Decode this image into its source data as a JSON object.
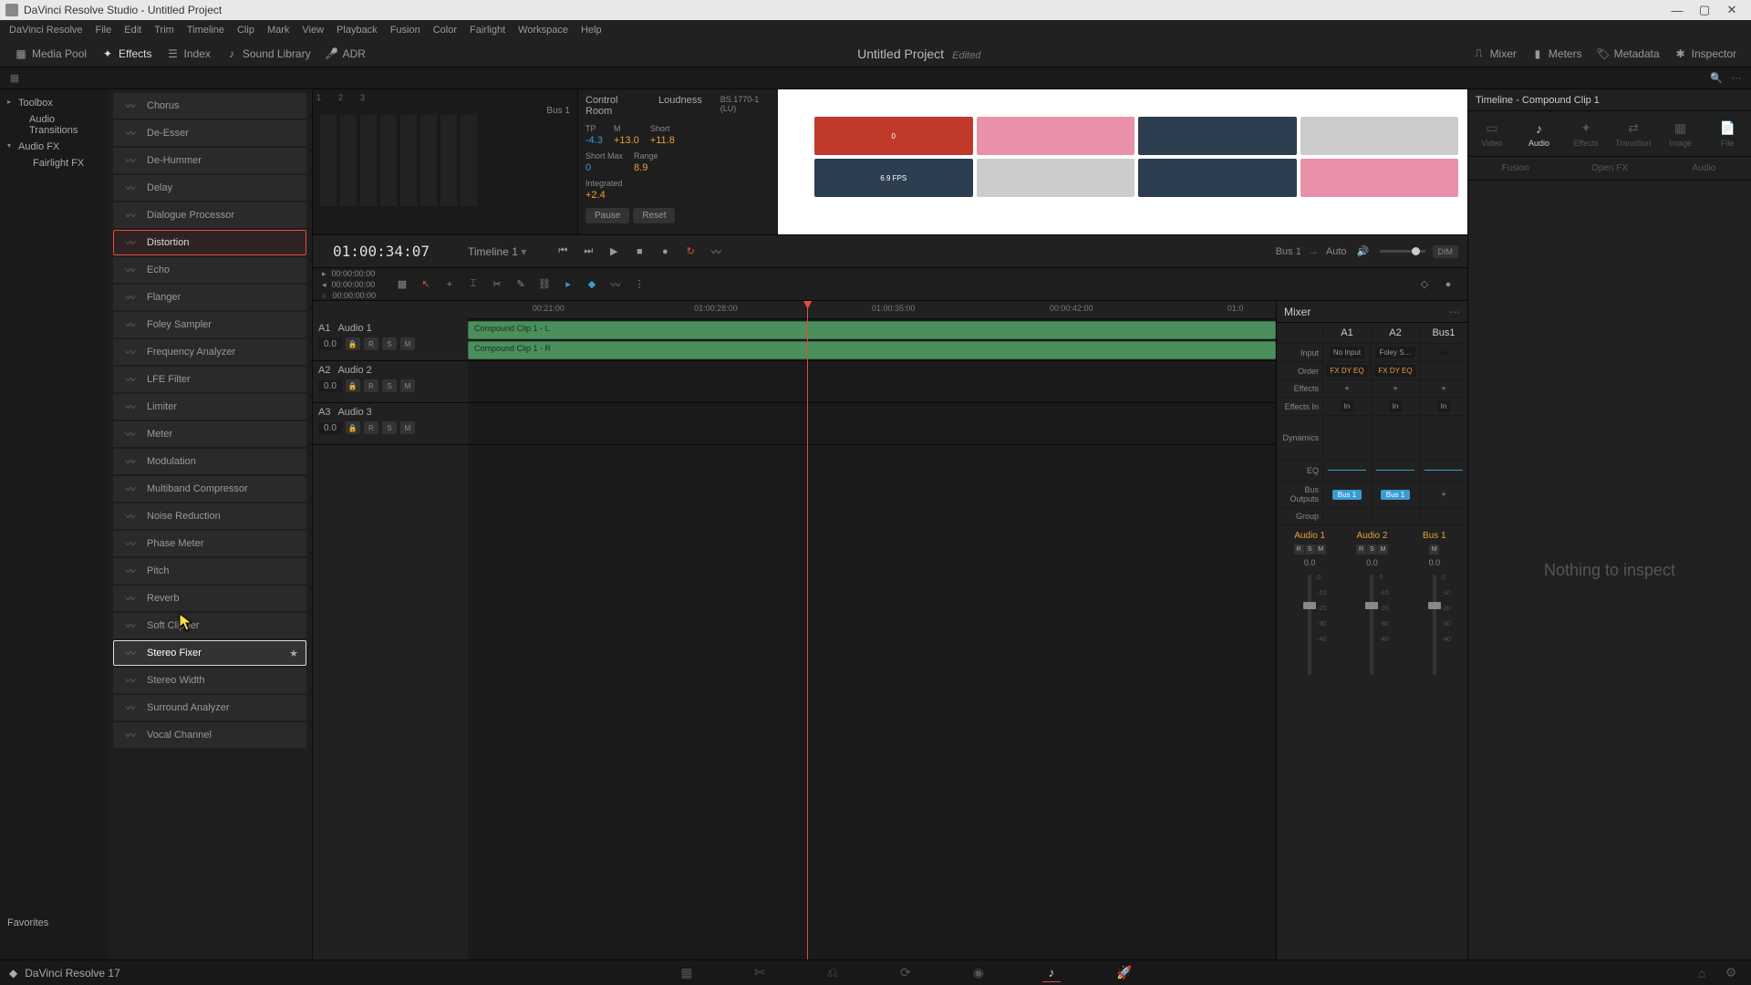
{
  "window": {
    "title": "DaVinci Resolve Studio - Untitled Project"
  },
  "menubar": [
    "DaVinci Resolve",
    "File",
    "Edit",
    "Trim",
    "Timeline",
    "Clip",
    "Mark",
    "View",
    "Playback",
    "Fusion",
    "Color",
    "Fairlight",
    "Workspace",
    "Help"
  ],
  "toolbar": {
    "left": [
      {
        "label": "Media Pool"
      },
      {
        "label": "Effects",
        "active": true
      },
      {
        "label": "Index"
      },
      {
        "label": "Sound Library"
      },
      {
        "label": "ADR"
      }
    ],
    "project": "Untitled Project",
    "edited": "Edited",
    "right": [
      {
        "label": "Mixer"
      },
      {
        "label": "Meters"
      },
      {
        "label": "Metadata"
      },
      {
        "label": "Inspector"
      }
    ]
  },
  "tree": {
    "toolbox": "Toolbox",
    "audio_transitions": "Audio Transitions",
    "audio_fx": "Audio FX",
    "fairlight_fx": "Fairlight FX"
  },
  "fx": [
    "Chorus",
    "De-Esser",
    "De-Hummer",
    "Delay",
    "Dialogue Processor",
    "Distortion",
    "Echo",
    "Flanger",
    "Foley Sampler",
    "Frequency Analyzer",
    "LFE Filter",
    "Limiter",
    "Meter",
    "Modulation",
    "Multiband Compressor",
    "Noise Reduction",
    "Phase Meter",
    "Pitch",
    "Reverb",
    "Soft Clipper",
    "Stereo Fixer",
    "Stereo Width",
    "Surround Analyzer",
    "Vocal Channel"
  ],
  "fx_selected": 5,
  "fx_hover": 20,
  "favorites": "Favorites",
  "scopes": {
    "bus": "Bus 1",
    "control_room": "Control Room",
    "loudness_title": "Loudness",
    "loudness_std": "BS.1770-1 (LU)",
    "tp_label": "TP",
    "tp_val": "-4.3",
    "m_label": "M",
    "m_val": "+13.0",
    "short_label": "Short",
    "short_val": "+11.8",
    "shortmax_label": "Short Max",
    "shortmax_val": "0",
    "range_label": "Range",
    "range_val": "8.9",
    "integrated_label": "Integrated",
    "integrated_val": "+2.4",
    "pause": "Pause",
    "reset": "Reset"
  },
  "transport": {
    "timecode": "01:00:34:07",
    "timeline": "Timeline 1",
    "subtc": [
      "00:00:00:00",
      "00:00:00:00",
      "00:00:00:00"
    ],
    "bus": "Bus 1",
    "auto": "Auto",
    "dim": "DIM"
  },
  "ruler": [
    "00:21:00",
    "01:00:28:00",
    "01:00:35:00",
    "00:00:42:00",
    "01:0"
  ],
  "tracks": [
    {
      "id": "A1",
      "name": "Audio 1",
      "val": "0.0"
    },
    {
      "id": "A2",
      "name": "Audio 2",
      "val": "0.0"
    },
    {
      "id": "A3",
      "name": "Audio 3",
      "val": "0.0"
    }
  ],
  "clips": {
    "l": "Compound Clip 1 - L",
    "r": "Compound Clip 1 - R"
  },
  "mixer": {
    "title": "Mixer",
    "channels": [
      "A1",
      "A2",
      "Bus1"
    ],
    "rows": {
      "input": "Input",
      "order": "Order",
      "effects": "Effects",
      "effects_in": "Effects In",
      "dynamics": "Dynamics",
      "eq": "EQ",
      "bus_outputs": "Bus Outputs",
      "group": "Group"
    },
    "inputs": [
      "No Input",
      "Foley S…",
      ""
    ],
    "order": [
      "FX DY EQ",
      "FX DY EQ",
      ""
    ],
    "effects": [
      "+",
      "+",
      "+"
    ],
    "effects_in": [
      "In",
      "In",
      "In"
    ],
    "bus_out": [
      "Bus 1",
      "Bus 1",
      ""
    ],
    "fader_labels": [
      "Audio 1",
      "Audio 2",
      "Bus 1"
    ],
    "fader_val": "0.0",
    "scale": [
      "0",
      "-10",
      "-20",
      "-30",
      "-40"
    ]
  },
  "inspector": {
    "title": "Timeline - Compound Clip 1",
    "tabs": [
      "Video",
      "Audio",
      "Effects",
      "Transition",
      "Image",
      "File"
    ],
    "subtabs": [
      "Fusion",
      "Open FX",
      "Audio"
    ],
    "empty": "Nothing to inspect"
  },
  "page_bar": {
    "app": "DaVinci Resolve 17"
  },
  "viewer_thumbs": [
    "0",
    "",
    "",
    "",
    "6.9 FPS",
    "",
    "",
    ""
  ]
}
